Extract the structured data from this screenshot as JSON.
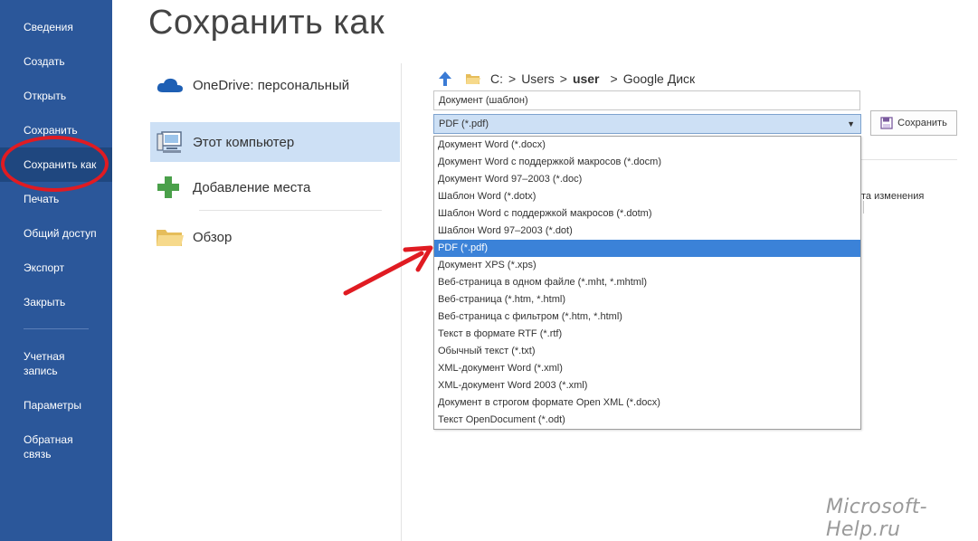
{
  "sidebar": {
    "items": [
      {
        "label": "Сведения"
      },
      {
        "label": "Создать"
      },
      {
        "label": "Открыть"
      },
      {
        "label": "Сохранить"
      },
      {
        "label": "Сохранить как"
      },
      {
        "label": "Печать"
      },
      {
        "label": "Общий доступ"
      },
      {
        "label": "Экспорт"
      },
      {
        "label": "Закрыть"
      },
      {
        "label_line1": "Учетная",
        "label_line2": "запись"
      },
      {
        "label": "Параметры"
      },
      {
        "label_line1": "Обратная",
        "label_line2": "связь"
      }
    ],
    "active_index": 4,
    "background": "#2b579a",
    "active_background": "#1f477f"
  },
  "main": {
    "title": "Сохранить как",
    "places": [
      {
        "label": "OneDrive: персональный",
        "icon": "cloud-icon"
      },
      {
        "label": "Этот компьютер",
        "icon": "computer-icon"
      },
      {
        "label": "Добавление места",
        "icon": "plus-icon"
      },
      {
        "label": "Обзор",
        "icon": "folder-icon"
      }
    ],
    "selected_place_index": 1
  },
  "breadcrumb": {
    "parts": [
      "C:",
      ">",
      "Users",
      ">",
      "user",
      ">",
      "Google Диск"
    ]
  },
  "file": {
    "name_value": "Документ (шаблон)",
    "type_value": "PDF (*.pdf)",
    "save_label": "Сохранить",
    "behind_text": "та изменения"
  },
  "dropdown": {
    "options": [
      "Документ Word (*.docx)",
      "Документ Word с поддержкой макросов (*.docm)",
      "Документ Word 97–2003 (*.doc)",
      "Шаблон Word (*.dotx)",
      "Шаблон Word с поддержкой макросов (*.dotm)",
      "Шаблон Word 97–2003 (*.dot)",
      "PDF (*.pdf)",
      "Документ XPS (*.xps)",
      "Веб-страница в одном файле (*.mht, *.mhtml)",
      "Веб-страница (*.htm, *.html)",
      "Веб-страница с фильтром (*.htm, *.html)",
      "Текст в формате RTF (*.rtf)",
      "Обычный текст (*.txt)",
      "XML-документ Word (*.xml)",
      "XML-документ Word 2003 (*.xml)",
      "Документ в строгом формате Open XML (*.docx)",
      "Текст OpenDocument (*.odt)"
    ],
    "selected_index": 6,
    "highlight_color": "#3b82d8"
  },
  "annotations": {
    "color": "#e01b22"
  },
  "watermark": "Microsoft-Help.ru"
}
